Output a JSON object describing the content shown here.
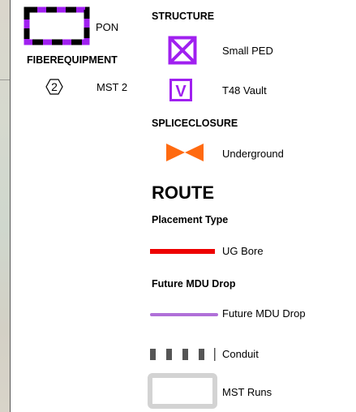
{
  "map": {
    "background_color": "#d4d6cc"
  },
  "legend": {
    "pon": {
      "label": "PON",
      "icon": "pon-boundary-dashed-box",
      "colors": [
        "#a020f0",
        "#000000"
      ]
    },
    "fiber_equipment": {
      "heading": "FIBEREQUIPMENT",
      "items": [
        {
          "icon": "mst-hexagon-icon",
          "symbol": "2",
          "label": "MST 2"
        }
      ]
    },
    "structure": {
      "heading": "STRUCTURE",
      "items": [
        {
          "icon": "small-ped-icon",
          "label": "Small PED",
          "color": "#a020f0"
        },
        {
          "icon": "vault-icon",
          "symbol": "V",
          "label": "T48 Vault",
          "color": "#a020f0"
        }
      ]
    },
    "splice_closure": {
      "heading": "SPLICECLOSURE",
      "items": [
        {
          "icon": "bowtie-icon",
          "label": "Underground",
          "color": "#ff6a10"
        }
      ]
    },
    "route": {
      "heading": "ROUTE",
      "placement_type": {
        "heading": "Placement Type",
        "items": [
          {
            "icon": "red-line-icon",
            "label": "UG Bore",
            "color": "#ee0000"
          }
        ]
      },
      "future_mdu_drop": {
        "heading": "Future MDU Drop",
        "items": [
          {
            "icon": "purple-line-icon",
            "label": "Future MDU Drop",
            "color": "#b070d8"
          }
        ]
      },
      "other": [
        {
          "icon": "conduit-dashed-icon",
          "label": "Conduit",
          "color": "#555555"
        },
        {
          "icon": "mst-runs-box-icon",
          "label": "MST Runs",
          "color": "#d3d3d3"
        }
      ]
    }
  }
}
